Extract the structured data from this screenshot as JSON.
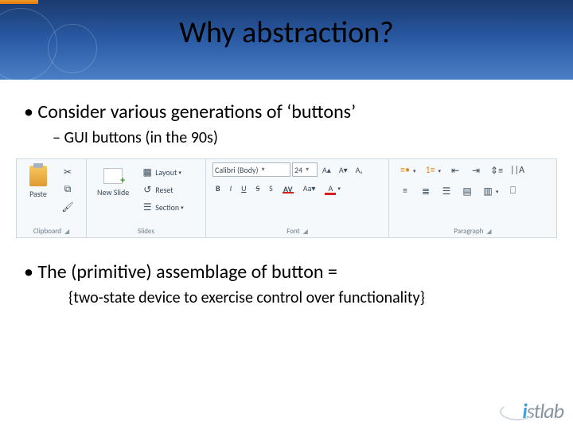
{
  "title": "Why abstraction?",
  "bullets": {
    "consider": "Consider various generations of ‘buttons’",
    "gui": "GUI buttons (in the 90s)"
  },
  "ribbon": {
    "clipboard": {
      "paste": "Paste",
      "label": "Clipboard"
    },
    "slides": {
      "new_slide": "New Slide",
      "layout": "Layout",
      "reset": "Reset",
      "section": "Section",
      "label": "Slides"
    },
    "font": {
      "name": "Calibri (Body)",
      "size": "24",
      "bold": "B",
      "italic": "I",
      "underline": "U",
      "strike": "S",
      "label": "Font"
    },
    "paragraph": {
      "label": "Paragraph"
    }
  },
  "assemblage_line": "The (primitive) assemblage of button =",
  "assemblage_def": "{two-state device to exercise control over functionality}",
  "brand": "istlab"
}
